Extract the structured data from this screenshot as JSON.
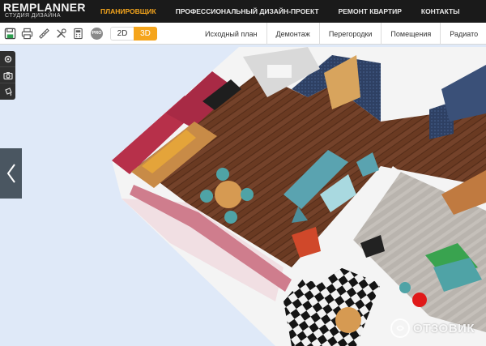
{
  "brand": {
    "logo_main": "REMPLANNER",
    "logo_sub": "СТУДИЯ ДИЗАЙНА"
  },
  "nav": {
    "items": [
      {
        "label": "ПЛАНИРОВЩИК",
        "active": true
      },
      {
        "label": "ПРОФЕССИОНАЛЬНЫЙ ДИЗАЙН-ПРОЕКТ",
        "active": false
      },
      {
        "label": "РЕМОНТ КВАРТИР",
        "active": false
      },
      {
        "label": "КОНТАКТЫ",
        "active": false
      }
    ]
  },
  "toolbar": {
    "tools": [
      {
        "icon": "save-icon"
      },
      {
        "icon": "print-icon"
      },
      {
        "icon": "ruler-icon"
      },
      {
        "icon": "tools-icon"
      },
      {
        "icon": "calculator-icon"
      }
    ],
    "pro_label": "PRO",
    "view_2d": "2D",
    "view_3d": "3D",
    "active_view": "3D",
    "steps": [
      "Исходный план",
      "Демонтаж",
      "Перегородки",
      "Помещения",
      "Радиато"
    ]
  },
  "side_tools": [
    {
      "icon": "settings-icon"
    },
    {
      "icon": "camera-icon"
    },
    {
      "icon": "paint-bucket-icon"
    }
  ],
  "side_arrow_icon": "chevron-left-icon",
  "watermark": {
    "text": "ОТЗОВИК"
  },
  "colors": {
    "nav_bg": "#1a1a1a",
    "accent": "#f5a51c",
    "canvas_bg": "#dfe9f8",
    "floor_wood": "#6b3a22",
    "wall_red": "#b5304a",
    "wall_navy": "#2c3d5c"
  }
}
